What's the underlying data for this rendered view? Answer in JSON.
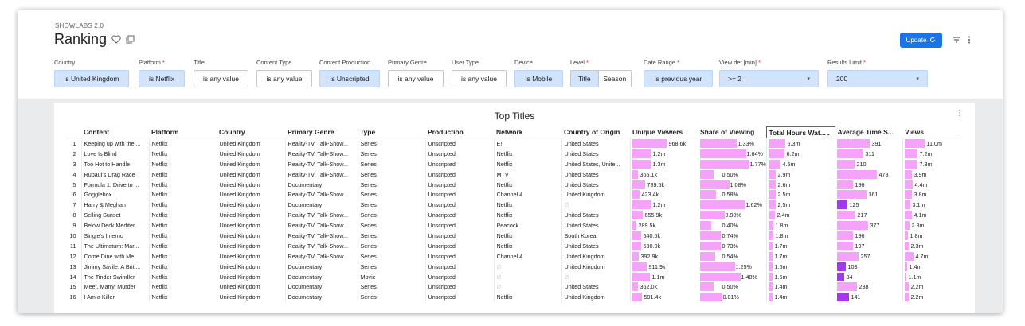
{
  "app_name": "SHOWLABS 2.0",
  "page_title": "Ranking",
  "update_label": "Update",
  "colors": {
    "accent": "#1a73e8",
    "chip_active": "#d2e3fc",
    "bar_light": "#f5a3fa",
    "bar_dark": "#a436f0"
  },
  "filters": [
    {
      "label": "Country",
      "value": "is United Kingdom",
      "required": ""
    },
    {
      "label": "Platform",
      "value": "is Netflix",
      "required": "*"
    },
    {
      "label": "Title",
      "value": "is any value",
      "required": ""
    },
    {
      "label": "Content Type",
      "value": "is any value",
      "required": ""
    },
    {
      "label": "Content Production",
      "value": "is Unscripted",
      "required": ""
    },
    {
      "label": "Primary Genre",
      "value": "is any value",
      "required": ""
    },
    {
      "label": "User Type",
      "value": "is any value",
      "required": ""
    },
    {
      "label": "Device",
      "value": "is Mobile",
      "required": ""
    },
    {
      "label": "Level",
      "value": "",
      "required": "*",
      "options": [
        "Title",
        "Season"
      ]
    },
    {
      "label": "Date Range",
      "value": "is previous year",
      "required": "*"
    },
    {
      "label": "View def [min]",
      "value": ">= 2",
      "required": "*"
    },
    {
      "label": "Results Limit",
      "value": "200",
      "required": "*"
    }
  ],
  "table": {
    "title": "Top Titles",
    "columns": [
      "",
      "Content",
      "Platform",
      "Country",
      "Primary Genre",
      "Type",
      "Production",
      "Network",
      "Country of Origin",
      "Unique Viewers",
      "Share of Viewing",
      "Total Hours Wat...",
      "Average Time S...",
      "Views"
    ],
    "rows": [
      {
        "n": "1",
        "content": "Keeping up with the ...",
        "platform": "Netflix",
        "country": "United Kingdom",
        "genre": "Reality-TV, Talk-Show...",
        "type": "Series",
        "production": "Unscripted",
        "network": "E!",
        "origin": "United States",
        "uv": "968.6k",
        "uv_f": 0.55,
        "sv": "1.33%",
        "sv_f": 0.6,
        "th": "6.3m",
        "th_f": 0.27,
        "at": "391",
        "at_f": 0.52,
        "vw": "11.0m",
        "vw_f": 0.32
      },
      {
        "n": "2",
        "content": "Love Is Blind",
        "platform": "Netflix",
        "country": "United Kingdom",
        "genre": "Reality-TV, Talk-Show...",
        "type": "Series",
        "production": "Unscripted",
        "network": "Netflix",
        "origin": "United States",
        "uv": "1.2m",
        "uv_f": 0.3,
        "sv": "1.64%",
        "sv_f": 0.74,
        "th": "6.2m",
        "th_f": 0.26,
        "at": "311",
        "at_f": 0.42,
        "vw": "7.2m",
        "vw_f": 0.21
      },
      {
        "n": "3",
        "content": "Too Hot to Handle",
        "platform": "Netflix",
        "country": "United Kingdom",
        "genre": "Reality-TV, Talk-Show...",
        "type": "Series",
        "production": "Unscripted",
        "network": "Netflix",
        "origin": "United States, Unite...",
        "uv": "1.3m",
        "uv_f": 0.3,
        "sv": "1.77%",
        "sv_f": 0.79,
        "th": "4.5m",
        "th_f": 0.19,
        "at": "210",
        "at_f": 0.28,
        "vw": "7.3m",
        "vw_f": 0.21
      },
      {
        "n": "4",
        "content": "Rupaul's Drag Race",
        "platform": "Netflix",
        "country": "United Kingdom",
        "genre": "Reality-TV, Talk-Show...",
        "type": "Series",
        "production": "Unscripted",
        "network": "MTV",
        "origin": "United States",
        "uv": "365.1k",
        "uv_f": 0.09,
        "sv": "0.50%",
        "sv_f": 0.22,
        "th": "2.9m",
        "th_f": 0.12,
        "at": "478",
        "at_f": 0.64,
        "vw": "3.9m",
        "vw_f": 0.11
      },
      {
        "n": "5",
        "content": "Formula 1: Drive to ...",
        "platform": "Netflix",
        "country": "United Kingdom",
        "genre": "Documentary",
        "type": "Series",
        "production": "Unscripted",
        "network": "Netflix",
        "origin": "United States",
        "uv": "789.5k",
        "uv_f": 0.2,
        "sv": "1.08%",
        "sv_f": 0.48,
        "th": "2.6m",
        "th_f": 0.11,
        "at": "196",
        "at_f": 0.26,
        "vw": "4.4m",
        "vw_f": 0.13
      },
      {
        "n": "6",
        "content": "Gogglebox",
        "platform": "Netflix",
        "country": "United Kingdom",
        "genre": "Reality-TV, Talk-Show...",
        "type": "Series",
        "production": "Unscripted",
        "network": "Channel 4",
        "origin": "United Kingdom",
        "uv": "423.4k",
        "uv_f": 0.11,
        "sv": "0.58%",
        "sv_f": 0.26,
        "th": "2.5m",
        "th_f": 0.11,
        "at": "361",
        "at_f": 0.48,
        "vw": "3.8m",
        "vw_f": 0.11
      },
      {
        "n": "7",
        "content": "Harry & Meghan",
        "platform": "Netflix",
        "country": "United Kingdom",
        "genre": "Documentary",
        "type": "Series",
        "production": "Unscripted",
        "network": "Netflix",
        "origin": "∅",
        "uv": "1.2m",
        "uv_f": 0.3,
        "sv": "1.62%",
        "sv_f": 0.73,
        "th": "2.5m",
        "th_f": 0.11,
        "at": "125",
        "at_f": 0.17,
        "vw": "3.1m",
        "vw_f": 0.09
      },
      {
        "n": "8",
        "content": "Selling Sunset",
        "platform": "Netflix",
        "country": "United Kingdom",
        "genre": "Reality-TV, Talk-Show...",
        "type": "Series",
        "production": "Unscripted",
        "network": "Netflix",
        "origin": "United States",
        "uv": "655.9k",
        "uv_f": 0.17,
        "sv": "0.90%",
        "sv_f": 0.4,
        "th": "2.4m",
        "th_f": 0.1,
        "at": "217",
        "at_f": 0.29,
        "vw": "4.1m",
        "vw_f": 0.12
      },
      {
        "n": "9",
        "content": "Below Deck Mediter...",
        "platform": "Netflix",
        "country": "United Kingdom",
        "genre": "Reality-TV, Talk-Show...",
        "type": "Series",
        "production": "Unscripted",
        "network": "Peacock",
        "origin": "United States",
        "uv": "289.5k",
        "uv_f": 0.07,
        "sv": "0.40%",
        "sv_f": 0.18,
        "th": "1.8m",
        "th_f": 0.08,
        "at": "377",
        "at_f": 0.5,
        "vw": "2.8m",
        "vw_f": 0.08
      },
      {
        "n": "10",
        "content": "Single's Inferno",
        "platform": "Netflix",
        "country": "United Kingdom",
        "genre": "Reality-TV, Talk-Show...",
        "type": "Series",
        "production": "Unscripted",
        "network": "Netflix",
        "origin": "South Korea",
        "uv": "540.6k",
        "uv_f": 0.14,
        "sv": "0.74%",
        "sv_f": 0.33,
        "th": "1.8m",
        "th_f": 0.08,
        "at": "196",
        "at_f": 0.26,
        "vw": "1.8m",
        "vw_f": 0.05
      },
      {
        "n": "11",
        "content": "The Ultimatum: Mar...",
        "platform": "Netflix",
        "country": "United Kingdom",
        "genre": "Reality-TV, Talk-Show...",
        "type": "Series",
        "production": "Unscripted",
        "network": "Netflix",
        "origin": "United States",
        "uv": "530.0k",
        "uv_f": 0.14,
        "sv": "0.73%",
        "sv_f": 0.33,
        "th": "1.7m",
        "th_f": 0.07,
        "at": "197",
        "at_f": 0.26,
        "vw": "2.3m",
        "vw_f": 0.07
      },
      {
        "n": "12",
        "content": "Come Dine with Me",
        "platform": "Netflix",
        "country": "United Kingdom",
        "genre": "Reality-TV, Talk-Show...",
        "type": "Series",
        "production": "Unscripted",
        "network": "Channel 4",
        "origin": "United Kingdom",
        "uv": "392.9k",
        "uv_f": 0.1,
        "sv": "0.54%",
        "sv_f": 0.24,
        "th": "1.7m",
        "th_f": 0.07,
        "at": "257",
        "at_f": 0.34,
        "vw": "4.7m",
        "vw_f": 0.14
      },
      {
        "n": "13",
        "content": "Jimmy Savile: A Briti...",
        "platform": "Netflix",
        "country": "United Kingdom",
        "genre": "Documentary",
        "type": "Series",
        "production": "Unscripted",
        "network": "∅",
        "origin": "United Kingdom",
        "uv": "911.9k",
        "uv_f": 0.23,
        "sv": "1.25%",
        "sv_f": 0.56,
        "th": "1.6m",
        "th_f": 0.07,
        "at": "103",
        "at_f": 0.14,
        "vw": "1.4m",
        "vw_f": 0.04
      },
      {
        "n": "14",
        "content": "The Tinder Swindler",
        "platform": "Netflix",
        "country": "United Kingdom",
        "genre": "Documentary",
        "type": "Movie",
        "production": "Unscripted",
        "network": "∅",
        "origin": "∅",
        "uv": "1.1m",
        "uv_f": 0.28,
        "sv": "1.48%",
        "sv_f": 0.66,
        "th": "1.5m",
        "th_f": 0.06,
        "at": "84",
        "at_f": 0.11,
        "vw": "1.1m",
        "vw_f": 0.03
      },
      {
        "n": "15",
        "content": "Meet, Marry, Murder",
        "platform": "Netflix",
        "country": "United Kingdom",
        "genre": "Documentary",
        "type": "Series",
        "production": "Unscripted",
        "network": "∅",
        "origin": "United States",
        "uv": "362.0k",
        "uv_f": 0.09,
        "sv": "0.50%",
        "sv_f": 0.22,
        "th": "1.4m",
        "th_f": 0.06,
        "at": "238",
        "at_f": 0.32,
        "vw": "2.2m",
        "vw_f": 0.06
      },
      {
        "n": "16",
        "content": "I Am a Killer",
        "platform": "Netflix",
        "country": "United Kingdom",
        "genre": "Documentary",
        "type": "Series",
        "production": "Unscripted",
        "network": "Netflix",
        "origin": "United Kingdom",
        "uv": "591.4k",
        "uv_f": 0.15,
        "sv": "0.81%",
        "sv_f": 0.36,
        "th": "1.4m",
        "th_f": 0.06,
        "at": "141",
        "at_f": 0.19,
        "vw": "2.2m",
        "vw_f": 0.06
      }
    ]
  }
}
